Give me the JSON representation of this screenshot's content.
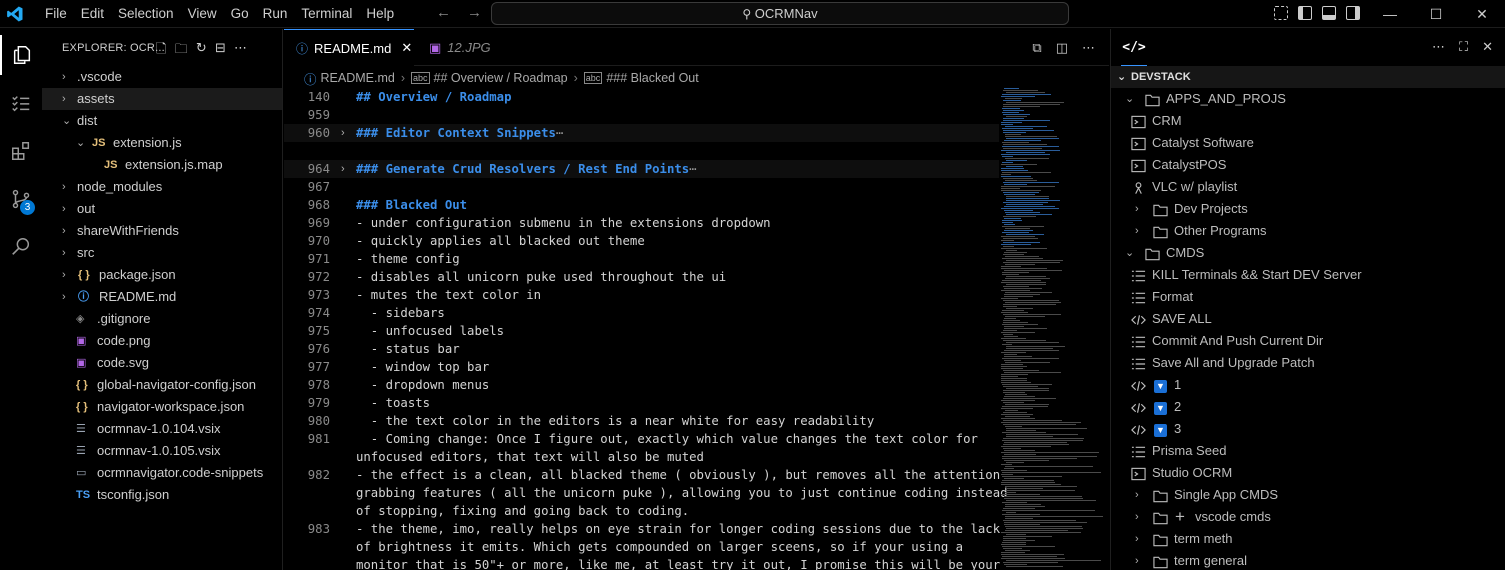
{
  "titlebar": {
    "menu": [
      "File",
      "Edit",
      "Selection",
      "View",
      "Go",
      "Run",
      "Terminal",
      "Help"
    ],
    "search": "OCRMNav",
    "minimize": "—",
    "maximize": "☐",
    "close": "✕"
  },
  "activitybar": {
    "scm_badge": "3"
  },
  "sidebar": {
    "title": "EXPLORER: OCR...",
    "tree": [
      {
        "label": ".vscode",
        "kind": "folder",
        "depth": 0,
        "open": false
      },
      {
        "label": "assets",
        "kind": "folder",
        "depth": 0,
        "open": false
      },
      {
        "label": "dist",
        "kind": "folder",
        "depth": 0,
        "open": true
      },
      {
        "label": "extension.js",
        "kind": "js",
        "depth": 1,
        "open": true,
        "chev": true
      },
      {
        "label": "extension.js.map",
        "kind": "js",
        "depth": 2
      },
      {
        "label": "node_modules",
        "kind": "folder",
        "depth": 0,
        "open": false
      },
      {
        "label": "out",
        "kind": "folder",
        "depth": 0,
        "open": false
      },
      {
        "label": "shareWithFriends",
        "kind": "folder",
        "depth": 0,
        "open": false
      },
      {
        "label": "src",
        "kind": "folder",
        "depth": 0,
        "open": false
      },
      {
        "label": "package.json",
        "kind": "json",
        "depth": 0,
        "chev": true
      },
      {
        "label": "README.md",
        "kind": "info",
        "depth": 0,
        "chev": true
      },
      {
        "label": ".gitignore",
        "kind": "git",
        "depth": 0
      },
      {
        "label": "code.png",
        "kind": "img",
        "depth": 0
      },
      {
        "label": "code.svg",
        "kind": "img",
        "depth": 0
      },
      {
        "label": "global-navigator-config.json",
        "kind": "json",
        "depth": 0
      },
      {
        "label": "navigator-workspace.json",
        "kind": "json",
        "depth": 0
      },
      {
        "label": "ocrmnav-1.0.104.vsix",
        "kind": "vsix",
        "depth": 0
      },
      {
        "label": "ocrmnav-1.0.105.vsix",
        "kind": "vsix",
        "depth": 0
      },
      {
        "label": "ocrmnavigator.code-snippets",
        "kind": "snip",
        "depth": 0
      },
      {
        "label": "tsconfig.json",
        "kind": "ts",
        "depth": 0
      }
    ]
  },
  "editor": {
    "tabs": [
      {
        "label": "README.md",
        "active": true
      },
      {
        "label": "12.JPG",
        "active": false
      }
    ],
    "breadcrumb": [
      "README.md",
      "## Overview / Roadmap",
      "### Blacked Out"
    ],
    "lines": [
      {
        "n": "140",
        "text": "## Overview / Roadmap",
        "type": "h"
      },
      {
        "n": "959",
        "text": "",
        "type": "t"
      },
      {
        "n": "960",
        "text": "### Editor Context Snippets",
        "type": "h",
        "fold": true
      },
      {
        "n": "",
        "text": "",
        "type": "t"
      },
      {
        "n": "964",
        "text": "### Generate Crud Resolvers / Rest End Points",
        "type": "h",
        "fold": true
      },
      {
        "n": "967",
        "text": "",
        "type": "t"
      },
      {
        "n": "968",
        "text": "### Blacked Out",
        "type": "h"
      },
      {
        "n": "969",
        "text": "- under configuration submenu in the extensions dropdown",
        "type": "t"
      },
      {
        "n": "970",
        "text": "- quickly applies all blacked out theme",
        "type": "t"
      },
      {
        "n": "971",
        "text": "- theme config",
        "type": "t"
      },
      {
        "n": "972",
        "text": "- disables all unicorn puke used throughout the ui",
        "type": "t"
      },
      {
        "n": "973",
        "text": "- mutes the text color in",
        "type": "t"
      },
      {
        "n": "974",
        "text": "  - sidebars",
        "type": "t"
      },
      {
        "n": "975",
        "text": "  - unfocused labels",
        "type": "t"
      },
      {
        "n": "976",
        "text": "  - status bar",
        "type": "t"
      },
      {
        "n": "977",
        "text": "  - window top bar",
        "type": "t"
      },
      {
        "n": "978",
        "text": "  - dropdown menus",
        "type": "t"
      },
      {
        "n": "979",
        "text": "  - toasts",
        "type": "t"
      },
      {
        "n": "980",
        "text": "  - the text color in the editors is a near white for easy readability",
        "type": "t"
      },
      {
        "n": "981",
        "text": "  - Coming change: Once I figure out, exactly which value changes the text color for",
        "type": "t"
      },
      {
        "n": "",
        "text": "unfocused editors, that text will also be muted",
        "type": "t"
      },
      {
        "n": "982",
        "text": "- the effect is a clean, all blacked theme ( obviously ), but removes all the attention",
        "type": "t"
      },
      {
        "n": "",
        "text": "grabbing features ( all the unicorn puke ), allowing you to just continue coding instead",
        "type": "t"
      },
      {
        "n": "",
        "text": "of stopping, fixing and going back to coding.",
        "type": "t"
      },
      {
        "n": "983",
        "text": "- the theme, imo, really helps on eye strain for longer coding sessions due to the lack",
        "type": "t"
      },
      {
        "n": "",
        "text": "of brightness it emits. Which gets compounded on larger sceens, so if your using a",
        "type": "t"
      },
      {
        "n": "",
        "text": "monitor that is 50\"+ or more, like me, at least try it out, I promise this will be your",
        "type": "t"
      }
    ]
  },
  "panel": {
    "section": "DEVSTACK",
    "rows": [
      {
        "label": "APPS_AND_PROJS",
        "icon": "folder",
        "depth": 0,
        "chev": "open"
      },
      {
        "label": "CRM",
        "icon": "terminal",
        "depth": 1
      },
      {
        "label": "Catalyst Software",
        "icon": "terminal",
        "depth": 1
      },
      {
        "label": "CatalystPOS",
        "icon": "terminal",
        "depth": 1
      },
      {
        "label": "VLC w/ playlist",
        "icon": "linux",
        "depth": 1
      },
      {
        "label": "Dev Projects",
        "icon": "folder",
        "depth": 1,
        "chev": "closed"
      },
      {
        "label": "Other Programs",
        "icon": "folder",
        "depth": 1,
        "chev": "closed"
      },
      {
        "label": "CMDS",
        "icon": "folder",
        "depth": 0,
        "chev": "open"
      },
      {
        "label": "KILL Terminals && Start DEV Server",
        "icon": "list",
        "depth": 1
      },
      {
        "label": "Format",
        "icon": "list",
        "depth": 1
      },
      {
        "label": "SAVE ALL",
        "icon": "code",
        "depth": 1
      },
      {
        "label": "Commit And Push Current Dir",
        "icon": "list",
        "depth": 1
      },
      {
        "label": "Save All and Upgrade Patch",
        "icon": "list",
        "depth": 1
      },
      {
        "label": "1",
        "icon": "code",
        "depth": 1,
        "check": true
      },
      {
        "label": "2",
        "icon": "code",
        "depth": 1,
        "check": true
      },
      {
        "label": "3",
        "icon": "code",
        "depth": 1,
        "check": true
      },
      {
        "label": "Prisma Seed",
        "icon": "list",
        "depth": 1
      },
      {
        "label": "Studio OCRM",
        "icon": "terminal",
        "depth": 1
      },
      {
        "label": "Single App CMDS",
        "icon": "folder",
        "depth": 1,
        "chev": "closed"
      },
      {
        "label": "vscode cmds",
        "icon": "folder",
        "depth": 1,
        "chev": "closed",
        "plus": true
      },
      {
        "label": "term meth",
        "icon": "folder",
        "depth": 1,
        "chev": "closed"
      },
      {
        "label": "term general",
        "icon": "folder",
        "depth": 1,
        "chev": "closed"
      }
    ]
  },
  "colors": {
    "accent": "#3794ff",
    "heading": "#3b8eea",
    "badge": "#0078d4"
  }
}
